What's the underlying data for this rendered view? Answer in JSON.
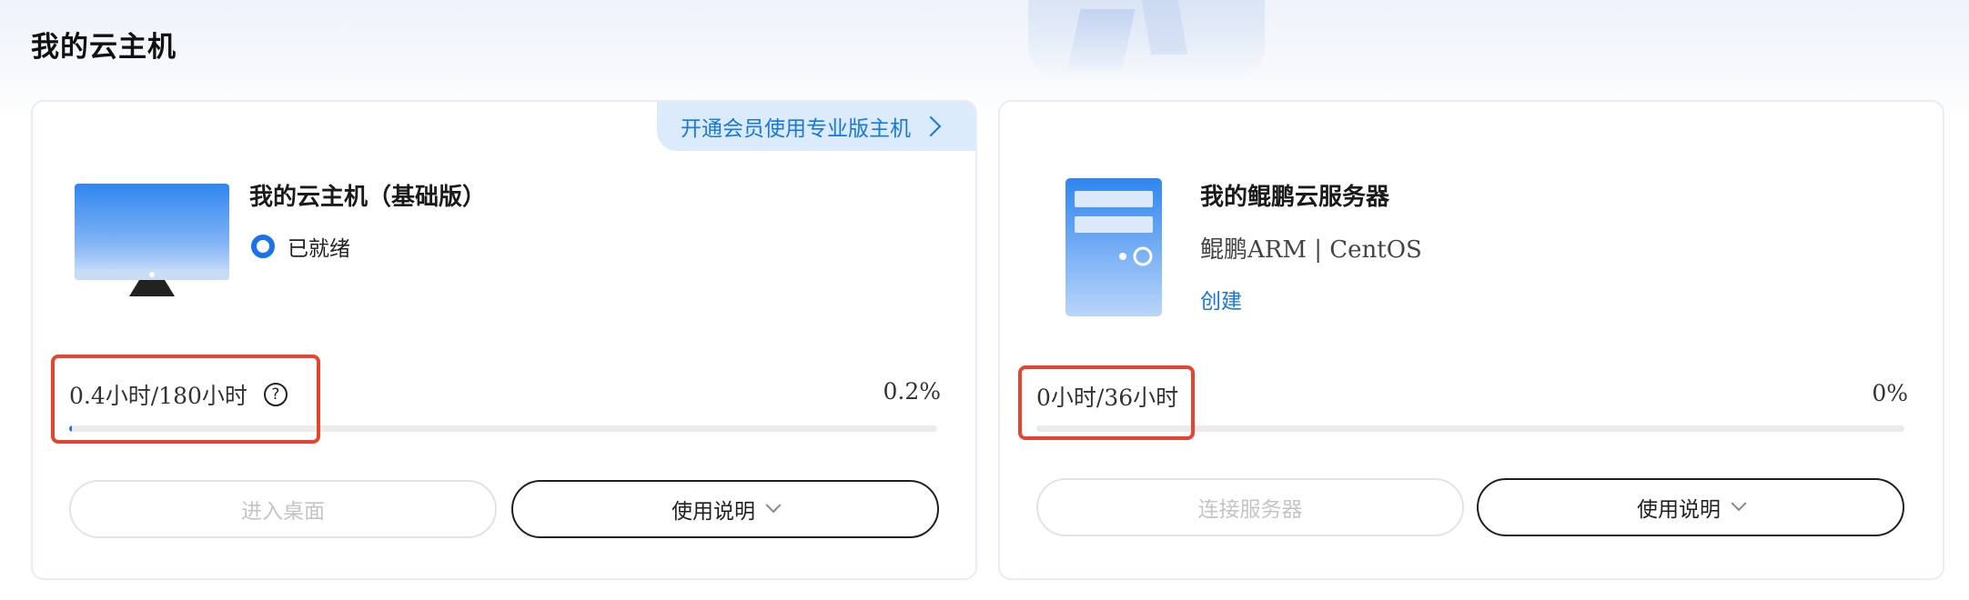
{
  "page": {
    "title": "我的云主机"
  },
  "cards": {
    "basic": {
      "promo_label": "开通会员使用专业版主机",
      "name": "我的云主机（基础版）",
      "status": "已就绪",
      "usage_text": "0.4小时/180小时",
      "help_glyph": "?",
      "percent_text": "0.2%",
      "progress_fraction": 0.002,
      "primary_button": "进入桌面",
      "secondary_button": "使用说明"
    },
    "kunpeng": {
      "name": "我的鲲鹏云服务器",
      "spec": "鲲鹏ARM | CentOS",
      "create_link": "创建",
      "usage_text": "0小时/36小时",
      "percent_text": "0%",
      "progress_fraction": 0,
      "primary_button": "连接服务器",
      "secondary_button": "使用说明"
    }
  },
  "colors": {
    "accent": "#1a73e8",
    "link": "#1677e6",
    "highlight": "#e8432e"
  },
  "icons": {
    "monitor": "monitor-icon",
    "server": "server-icon",
    "help": "help-circle-icon",
    "chevron_right": "chevron-right-icon",
    "chevron_down": "chevron-down-icon"
  }
}
